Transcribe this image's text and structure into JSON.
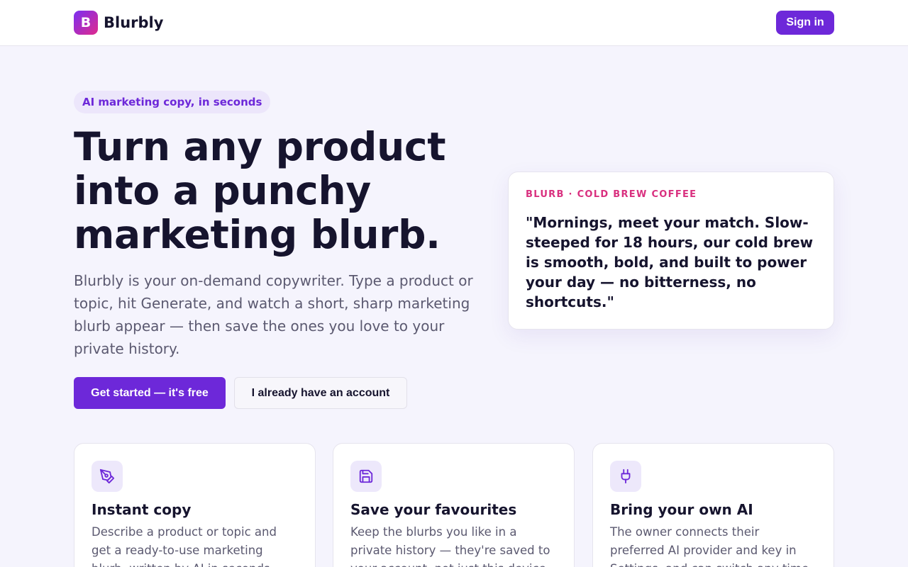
{
  "header": {
    "logo_letter": "B",
    "brand": "Blurbly",
    "signin_label": "Sign in"
  },
  "hero": {
    "pill": "AI marketing copy, in seconds",
    "title": "Turn any product into a punchy marketing blurb.",
    "subtitle": "Blurbly is your on-demand copywriter. Type a product or topic, hit Generate, and watch a short, sharp marketing blurb appear — then save the ones you love to your private history.",
    "primary_cta": "Get started — it's free",
    "secondary_cta": "I already have an account"
  },
  "blurb_card": {
    "kicker": "BLURB · COLD BREW COFFEE",
    "quote": "\"Mornings, meet your match. Slow-steeped for 18 hours, our cold brew is smooth, bold, and built to power your day — no bitterness, no shortcuts.\""
  },
  "features": [
    {
      "icon": "pen-tool-icon",
      "title": "Instant copy",
      "description": "Describe a product or topic and get a ready-to-use marketing blurb, written by AI in seconds."
    },
    {
      "icon": "save-icon",
      "title": "Save your favourites",
      "description": "Keep the blurbs you like in a private history — they're saved to your account, not just this device."
    },
    {
      "icon": "plug-icon",
      "title": "Bring your own AI",
      "description": "The owner connects their preferred AI provider and key in Settings, and can switch any time."
    }
  ],
  "colors": {
    "accent": "#6d28d9",
    "kicker": "#d9307f",
    "background": "#f5f4fd",
    "logo_gradient_start": "#7b2ff2",
    "logo_gradient_end": "#e02a8c"
  }
}
